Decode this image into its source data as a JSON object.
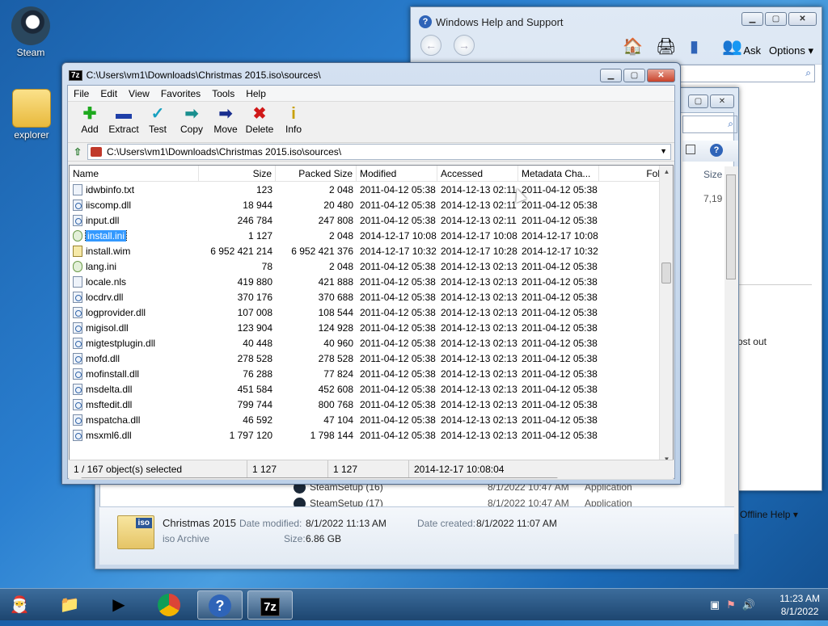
{
  "desktop": {
    "icons": [
      {
        "label": "Steam"
      },
      {
        "label": "explorer"
      }
    ]
  },
  "help_window": {
    "title": "Windows Help and Support",
    "ask": "Ask",
    "options": "Options",
    "offline": "Offline Help",
    "partial_text": "ost out"
  },
  "explorer_window": {
    "partial_size_header": "Size",
    "partial_size_value": "7,19",
    "rows": [
      {
        "name": "SteamSetup (16)",
        "date": "8/1/2022 10:47 AM",
        "type": "Application"
      },
      {
        "name": "SteamSetup (17)",
        "date": "8/1/2022 10:47 AM",
        "type": "Application"
      }
    ],
    "details": {
      "name": "Christmas 2015",
      "type": "iso Archive",
      "modified_label": "Date modified:",
      "modified_value": "8/1/2022 11:13 AM",
      "created_label": "Date created:",
      "created_value": "8/1/2022 11:07 AM",
      "size_label": "Size:",
      "size_value": "6.86 GB",
      "icon_text": "iso"
    }
  },
  "zip_window": {
    "title": "C:\\Users\\vm1\\Downloads\\Christmas 2015.iso\\sources\\",
    "menu": [
      "File",
      "Edit",
      "View",
      "Favorites",
      "Tools",
      "Help"
    ],
    "toolbar": [
      {
        "label": "Add",
        "icon": "add-icon",
        "glyph": "✚",
        "color": "#1ea91e"
      },
      {
        "label": "Extract",
        "icon": "extract-icon",
        "glyph": "▬",
        "color": "#1f3fa8"
      },
      {
        "label": "Test",
        "icon": "test-icon",
        "glyph": "✓",
        "color": "#16a0c0"
      },
      {
        "label": "Copy",
        "icon": "copy-icon",
        "glyph": "➡",
        "color": "#1a8f8f"
      },
      {
        "label": "Move",
        "icon": "move-icon",
        "glyph": "➡",
        "color": "#1a2f8f"
      },
      {
        "label": "Delete",
        "icon": "delete-icon",
        "glyph": "✖",
        "color": "#d01818"
      },
      {
        "label": "Info",
        "icon": "info-icon",
        "glyph": "i",
        "color": "#c8a000"
      }
    ],
    "address": "C:\\Users\\vm1\\Downloads\\Christmas 2015.iso\\sources\\",
    "columns": [
      "Name",
      "Size",
      "Packed Size",
      "Modified",
      "Accessed",
      "Metadata Cha...",
      "Fol"
    ],
    "files": [
      {
        "name": "idwbinfo.txt",
        "size": "123",
        "packed": "2 048",
        "modified": "2011-04-12 05:38",
        "accessed": "2014-12-13 02:11",
        "meta": "2011-04-12 05:38",
        "icon": "txt"
      },
      {
        "name": "iiscomp.dll",
        "size": "18 944",
        "packed": "20 480",
        "modified": "2011-04-12 05:38",
        "accessed": "2014-12-13 02:11",
        "meta": "2011-04-12 05:38",
        "icon": "gear"
      },
      {
        "name": "input.dll",
        "size": "246 784",
        "packed": "247 808",
        "modified": "2011-04-12 05:38",
        "accessed": "2014-12-13 02:11",
        "meta": "2011-04-12 05:38",
        "icon": "gear"
      },
      {
        "name": "install.ini",
        "size": "1 127",
        "packed": "2 048",
        "modified": "2014-12-17 10:08",
        "accessed": "2014-12-17 10:08",
        "meta": "2014-12-17 10:08",
        "icon": "ini",
        "selected": true
      },
      {
        "name": "install.wim",
        "size": "6 952 421 214",
        "packed": "6 952 421 376",
        "modified": "2014-12-17 10:32",
        "accessed": "2014-12-17 10:28",
        "meta": "2014-12-17 10:32",
        "icon": "wim"
      },
      {
        "name": "lang.ini",
        "size": "78",
        "packed": "2 048",
        "modified": "2011-04-12 05:38",
        "accessed": "2014-12-13 02:13",
        "meta": "2011-04-12 05:38",
        "icon": "ini"
      },
      {
        "name": "locale.nls",
        "size": "419 880",
        "packed": "421 888",
        "modified": "2011-04-12 05:38",
        "accessed": "2014-12-13 02:13",
        "meta": "2011-04-12 05:38",
        "icon": "file"
      },
      {
        "name": "locdrv.dll",
        "size": "370 176",
        "packed": "370 688",
        "modified": "2011-04-12 05:38",
        "accessed": "2014-12-13 02:13",
        "meta": "2011-04-12 05:38",
        "icon": "gear"
      },
      {
        "name": "logprovider.dll",
        "size": "107 008",
        "packed": "108 544",
        "modified": "2011-04-12 05:38",
        "accessed": "2014-12-13 02:13",
        "meta": "2011-04-12 05:38",
        "icon": "gear"
      },
      {
        "name": "migisol.dll",
        "size": "123 904",
        "packed": "124 928",
        "modified": "2011-04-12 05:38",
        "accessed": "2014-12-13 02:13",
        "meta": "2011-04-12 05:38",
        "icon": "gear"
      },
      {
        "name": "migtestplugin.dll",
        "size": "40 448",
        "packed": "40 960",
        "modified": "2011-04-12 05:38",
        "accessed": "2014-12-13 02:13",
        "meta": "2011-04-12 05:38",
        "icon": "gear"
      },
      {
        "name": "mofd.dll",
        "size": "278 528",
        "packed": "278 528",
        "modified": "2011-04-12 05:38",
        "accessed": "2014-12-13 02:13",
        "meta": "2011-04-12 05:38",
        "icon": "gear"
      },
      {
        "name": "mofinstall.dll",
        "size": "76 288",
        "packed": "77 824",
        "modified": "2011-04-12 05:38",
        "accessed": "2014-12-13 02:13",
        "meta": "2011-04-12 05:38",
        "icon": "gear"
      },
      {
        "name": "msdelta.dll",
        "size": "451 584",
        "packed": "452 608",
        "modified": "2011-04-12 05:38",
        "accessed": "2014-12-13 02:13",
        "meta": "2011-04-12 05:38",
        "icon": "gear"
      },
      {
        "name": "msftedit.dll",
        "size": "799 744",
        "packed": "800 768",
        "modified": "2011-04-12 05:38",
        "accessed": "2014-12-13 02:13",
        "meta": "2011-04-12 05:38",
        "icon": "gear"
      },
      {
        "name": "mspatcha.dll",
        "size": "46 592",
        "packed": "47 104",
        "modified": "2011-04-12 05:38",
        "accessed": "2014-12-13 02:13",
        "meta": "2011-04-12 05:38",
        "icon": "gear"
      },
      {
        "name": "msxml6.dll",
        "size": "1 797 120",
        "packed": "1 798 144",
        "modified": "2011-04-12 05:38",
        "accessed": "2014-12-13 02:13",
        "meta": "2011-04-12 05:38",
        "icon": "gear"
      }
    ],
    "status": {
      "selection": "1 / 167 object(s) selected",
      "size": "1 127",
      "packed": "1 127",
      "modified": "2014-12-17 10:08:04"
    }
  },
  "taskbar": {
    "clock_time": "11:23 AM",
    "clock_date": "8/1/2022",
    "seven_zip_label": "7z"
  }
}
